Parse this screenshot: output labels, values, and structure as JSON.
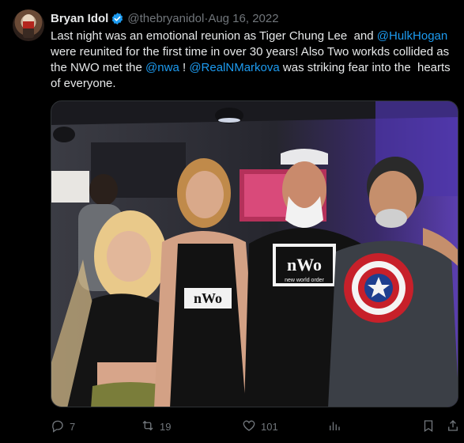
{
  "tweet": {
    "author_name": "Bryan Idol",
    "author_handle": "@thebryanidol",
    "separator": " · ",
    "date": "Aug 16, 2022",
    "text_parts": [
      "Last night was an emotional reunion as Tiger Chung Lee  and ",
      "@HulkHogan",
      " were reunited for the first time in over 30 years! Also Two workds collided as the NWO met the ",
      "@nwa",
      " ! ",
      "@RealNMarkova",
      " was striking fear into the  hearts of everyone."
    ],
    "photo_text": {
      "nwo_shirt_line1": "nWo",
      "nwo_shirt_line2": "new world order",
      "tank_logo": "nWo"
    }
  },
  "actions": {
    "replies": "7",
    "retweets": "19",
    "likes": "101"
  },
  "colors": {
    "link": "#1d9bf0",
    "muted": "#71767b",
    "text": "#e7e9ea",
    "background": "#000000"
  },
  "icons": [
    "verified-badge-icon",
    "reply-icon",
    "retweet-icon",
    "like-icon",
    "views-icon",
    "bookmark-icon",
    "share-icon"
  ]
}
